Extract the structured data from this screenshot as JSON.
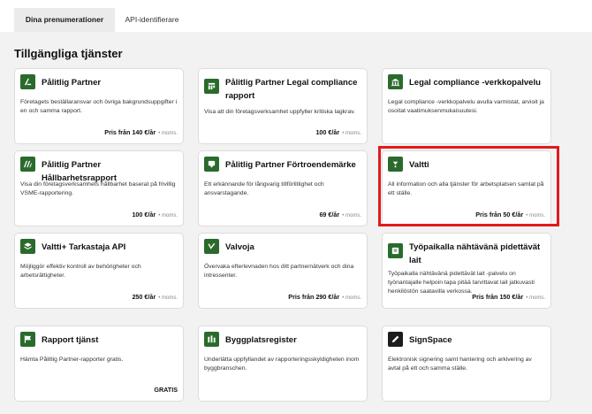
{
  "tabs": [
    {
      "label": "Dina prenumerationer",
      "active": true
    },
    {
      "label": "API-identifierare",
      "active": false
    }
  ],
  "section_title": "Tillgängliga tjänster",
  "vat_label": "• moms.",
  "cards": [
    {
      "name": "Pålitlig Partner",
      "icon": "partner-icon",
      "desc": "Företagets beställaransvar och övriga bakgrundsuppgifter i en och samma rapport.",
      "price": "Pris från 140 €/år"
    },
    {
      "name": "Pålitlig Partner Legal compliance rapport",
      "icon": "legal-report-icon",
      "desc": "Visa att din företagsverksamhet uppfyller kritiska lagkrav.",
      "price": "100 €/år"
    },
    {
      "name": "Legal compliance -verkkopalvelu",
      "icon": "building-icon",
      "desc": "Legal compliance -verkkopalvelu avulla varmistat, arvioit ja osoitat vaatimuksenmukaisuutesi.",
      "price": ""
    },
    {
      "name": "Pålitlig Partner Hållbarhetsrapport",
      "icon": "sustainability-icon",
      "desc": "Visa din företagsverksamhets hållbarhet baserat på frivillig VSME-rapportering.",
      "price": "100 €/år"
    },
    {
      "name": "Pålitlig Partner Förtroendemärke",
      "icon": "badge-icon",
      "desc": "Ett erkännande för långvarig tillförlitlighet och ansvarstagande.",
      "price": "69 €/år"
    },
    {
      "name": "Valtti",
      "icon": "valtti-icon",
      "desc": "All information och alla tjänster för arbetsplatsen samlat på ett ställe.",
      "price": "Pris från 50 €/år"
    },
    {
      "name": "Valtti+ Tarkastaja API",
      "icon": "layers-icon",
      "desc": "Möjliggör effektiv kontroll av behörigheter och arbetsrättigheter.",
      "price": "250 €/år"
    },
    {
      "name": "Valvoja",
      "icon": "check-icon",
      "desc": "Övervaka efterlevnaden hos ditt partnernätverk och dina intressenter.",
      "price": "Pris från 290 €/år"
    },
    {
      "name": "Työpaikalla nähtävänä pidettävät lait",
      "icon": "law-book-icon",
      "desc": "Työpaikalla nähtävänä pidettävät lait -palvelu on työnantajalle helpoin tapa pitää tarvittavat lait jatkuvasti henkilöstön saatavilla verkossa.",
      "price": "Pris från 150 €/år"
    },
    {
      "name": "Rapport tjänst",
      "icon": "flag-report-icon",
      "desc": "Hämta Pålitlig Partner-rapporter gratis.",
      "price": "GRATIS"
    },
    {
      "name": "Byggplatsregister",
      "icon": "site-register-icon",
      "desc": "Underlätta uppfyllandet av rapporteringsskyldigheten inom byggbranschen.",
      "price": ""
    },
    {
      "name": "SignSpace",
      "icon": "pen-icon",
      "desc": "Elektronisk signering samt hantering och arkivering av avtal på ett och samma ställe.",
      "price": ""
    }
  ],
  "colors": {
    "brand_green": "#2a6b2d",
    "highlight": "#e01b1b",
    "background": "#f2f2f2"
  }
}
